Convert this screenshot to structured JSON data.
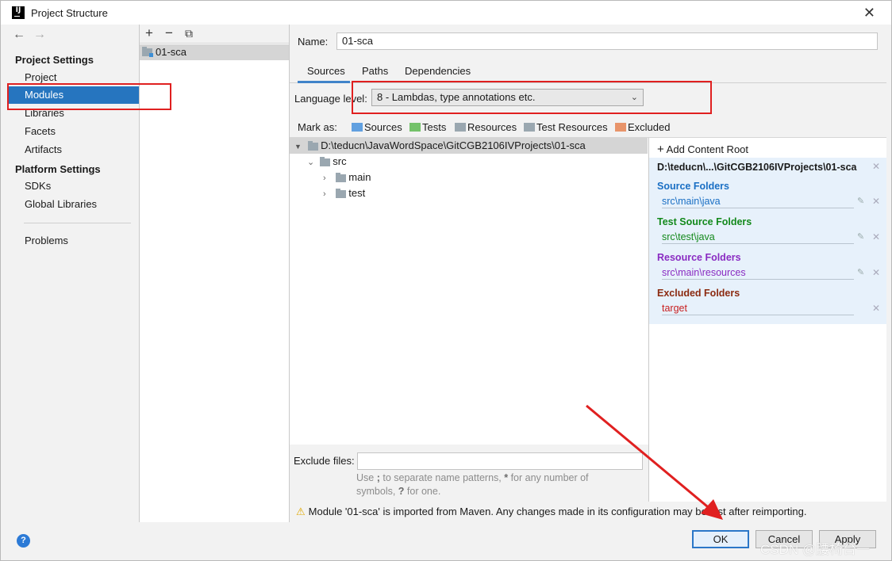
{
  "window": {
    "title": "Project Structure",
    "close_glyph": "✕"
  },
  "nav": {
    "back": "←",
    "forward": "→",
    "project_settings_header": "Project Settings",
    "items": [
      "Project",
      "Modules",
      "Libraries",
      "Facets",
      "Artifacts"
    ],
    "platform_settings_header": "Platform Settings",
    "platform_items": [
      "SDKs",
      "Global Libraries"
    ],
    "problems": "Problems",
    "selected": "Modules"
  },
  "modules": {
    "toolbar": {
      "add": "+",
      "remove": "−",
      "copy": "⧉"
    },
    "items": [
      "01-sca"
    ]
  },
  "module": {
    "name_label": "Name:",
    "name_value": "01-sca",
    "tabs": [
      "Sources",
      "Paths",
      "Dependencies"
    ],
    "active_tab": "Sources",
    "language_level_label": "Language level:",
    "language_level_value": "8 - Lambdas, type annotations etc.",
    "mark_as_label": "Mark as:",
    "mark_as": [
      {
        "label": "Sources",
        "color": "#61a0e0"
      },
      {
        "label": "Tests",
        "color": "#74c26a"
      },
      {
        "label": "Resources",
        "color": "#9aa7b0"
      },
      {
        "label": "Test Resources",
        "color": "#9aa7b0"
      },
      {
        "label": "Excluded",
        "color": "#e8946a"
      }
    ],
    "tree": {
      "root": "D:\\teducn\\JavaWordSpace\\GitCGB2106IVProjects\\01-sca",
      "children": [
        "src",
        "main",
        "test"
      ]
    },
    "content_roots": {
      "add_label": "Add Content Root",
      "path": "D:\\teducn\\...\\GitCGB2106IVProjects\\01-sca",
      "source_header": "Source Folders",
      "source_item": "src\\main\\java",
      "test_header": "Test Source Folders",
      "test_item": "src\\test\\java",
      "resource_header": "Resource Folders",
      "resource_item": "src\\main\\resources",
      "excluded_header": "Excluded Folders",
      "excluded_item": "target",
      "colors": {
        "source": "#1a6fc4",
        "test": "#13891b",
        "resource": "#8a2bc2",
        "excluded": "#8b2a10",
        "excluded_item": "#c81e1e"
      }
    },
    "exclude_files_label": "Exclude files:",
    "hint_line1_pre": "Use ",
    "hint_sep": ";",
    "hint_line1_mid": " to separate name patterns, ",
    "hint_star": "*",
    "hint_line1_post": " for any number of",
    "hint_line2_pre": "symbols, ",
    "hint_q": "?",
    "hint_line2_post": " for one.",
    "warning": "Module '01-sca' is imported from Maven. Any changes made in its configuration may be lost after reimporting."
  },
  "buttons": {
    "help": "?",
    "ok": "OK",
    "cancel": "Cancel",
    "apply": "Apply"
  },
  "watermark": "CSDN @腰椅台一",
  "colors": {
    "selection": "#2675bf",
    "annotation": "#e02020"
  }
}
